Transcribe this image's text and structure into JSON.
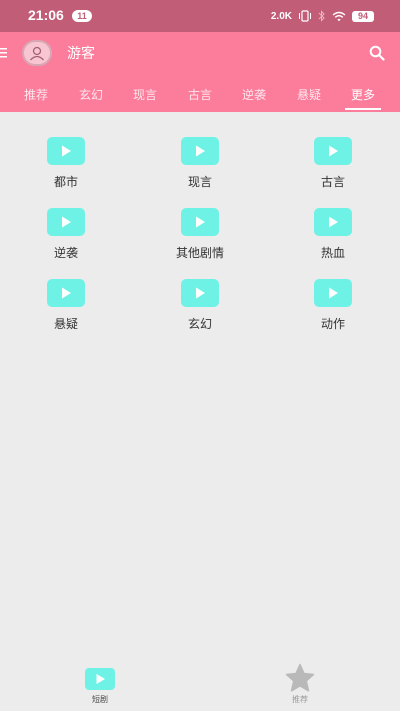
{
  "status_bar": {
    "time": "21:06",
    "notification_count": "11",
    "net_speed": "2.0K",
    "battery": "94"
  },
  "header": {
    "title": "游客"
  },
  "tabs": [
    {
      "label": "推荐",
      "active": false
    },
    {
      "label": "玄幻",
      "active": false
    },
    {
      "label": "现言",
      "active": false
    },
    {
      "label": "古言",
      "active": false
    },
    {
      "label": "逆袭",
      "active": false
    },
    {
      "label": "悬疑",
      "active": false
    },
    {
      "label": "更多",
      "active": true
    }
  ],
  "categories": [
    {
      "label": "都市"
    },
    {
      "label": "现言"
    },
    {
      "label": "古言"
    },
    {
      "label": "逆袭"
    },
    {
      "label": "其他剧情"
    },
    {
      "label": "热血"
    },
    {
      "label": "悬疑"
    },
    {
      "label": "玄幻"
    },
    {
      "label": "动作"
    }
  ],
  "bottom_nav": [
    {
      "label": "短剧",
      "icon": "play-icon",
      "active": true
    },
    {
      "label": "推荐",
      "icon": "star-icon",
      "active": false
    }
  ],
  "colors": {
    "status_bar": "#c25d78",
    "header": "#fb7d9b",
    "accent": "#6ff2e6",
    "background": "#ececec"
  }
}
